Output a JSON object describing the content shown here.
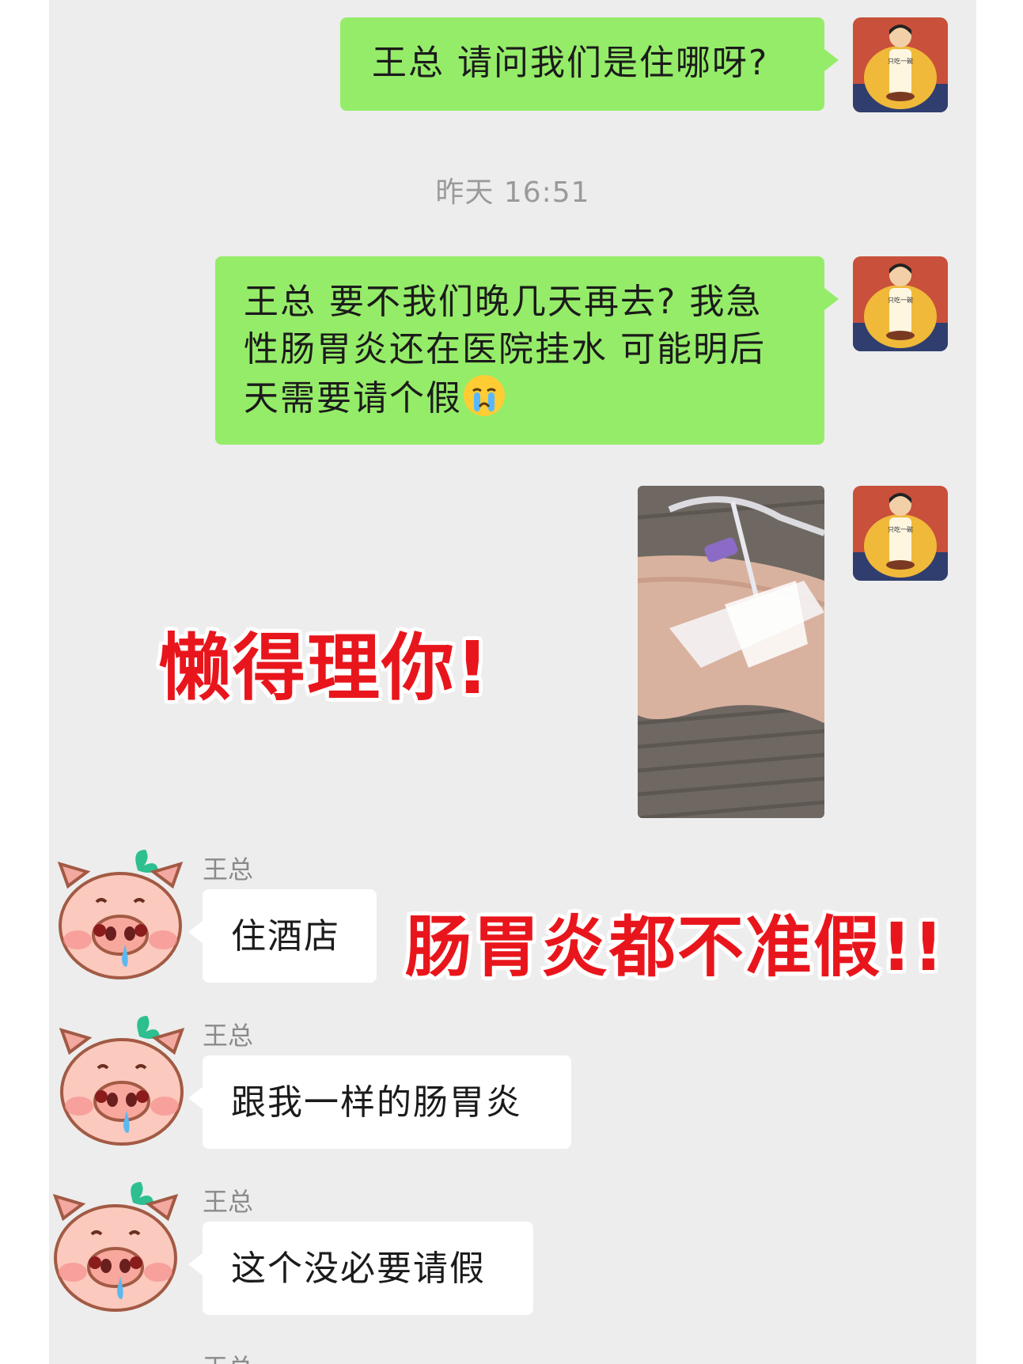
{
  "messages": {
    "m1": {
      "text": "王总 请问我们是住哪呀?"
    },
    "timestamp": "昨天 16:51",
    "m2": {
      "line1": "王总 要不我们晚几天再去? 我急",
      "line2": "性肠胃炎还在医院挂水 可能明后",
      "line3": "天需要请个假"
    },
    "m4": {
      "sender": "王总",
      "text": "住酒店"
    },
    "m5": {
      "sender": "王总",
      "text": "跟我一样的肠胃炎"
    },
    "m6": {
      "sender": "王总",
      "text": "这个没必要请假"
    },
    "m7": {
      "sender": "王总"
    }
  },
  "avatar_me": {
    "caption": "只吃一碗"
  },
  "overlays": {
    "top": "懒得理你!",
    "middle": "肠胃炎都不准假!!"
  },
  "colors": {
    "sent_bubble": "#95ec69",
    "received_bubble": "#ffffff",
    "chat_background": "#ededed",
    "overlay_text": "#e8161c"
  }
}
